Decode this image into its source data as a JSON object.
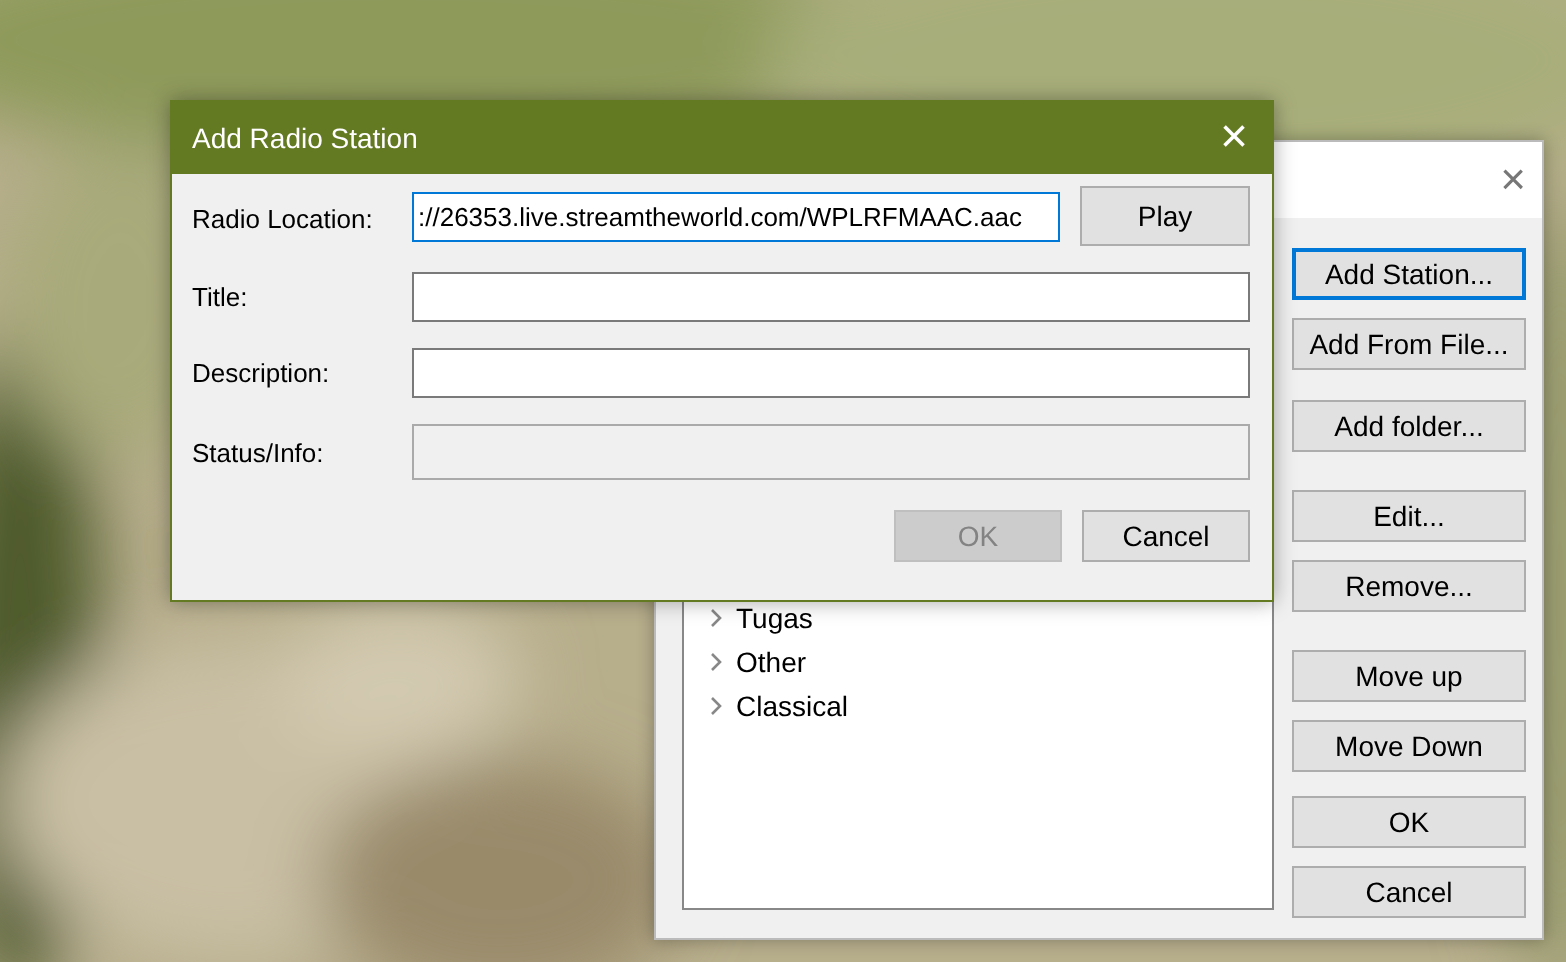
{
  "back_window": {
    "close": "×",
    "tree": [
      {
        "label": "Tugas",
        "expanded": false
      },
      {
        "label": "Other",
        "expanded": false
      },
      {
        "label": "Classical",
        "expanded": false
      }
    ],
    "buttons": [
      {
        "label": "Add Station...",
        "default": true
      },
      {
        "label": "Add From File...",
        "default": false
      },
      {
        "label": "Add folder...",
        "default": false
      },
      {
        "label": "Edit...",
        "default": false
      },
      {
        "label": "Remove...",
        "default": false
      },
      {
        "label": "Move up",
        "default": false
      },
      {
        "label": "Move Down",
        "default": false
      },
      {
        "label": "OK",
        "default": false
      },
      {
        "label": "Cancel",
        "default": false
      }
    ]
  },
  "dialog": {
    "title": "Add Radio Station",
    "close": "×",
    "fields": [
      {
        "label": "Radio Location:",
        "value": "://26353.live.streamtheworld.com/WPLRFMAAC.aac",
        "focused": true,
        "disabled": false
      },
      {
        "label": "Title:",
        "focused": false,
        "disabled": false
      },
      {
        "label": "Description:",
        "focused": false,
        "disabled": false
      },
      {
        "label": "Status/Info:",
        "focused": false,
        "disabled": true
      }
    ],
    "play_button": "Play",
    "buttons": [
      {
        "label": "OK",
        "disabled": true
      },
      {
        "label": "Cancel",
        "disabled": false
      }
    ]
  }
}
